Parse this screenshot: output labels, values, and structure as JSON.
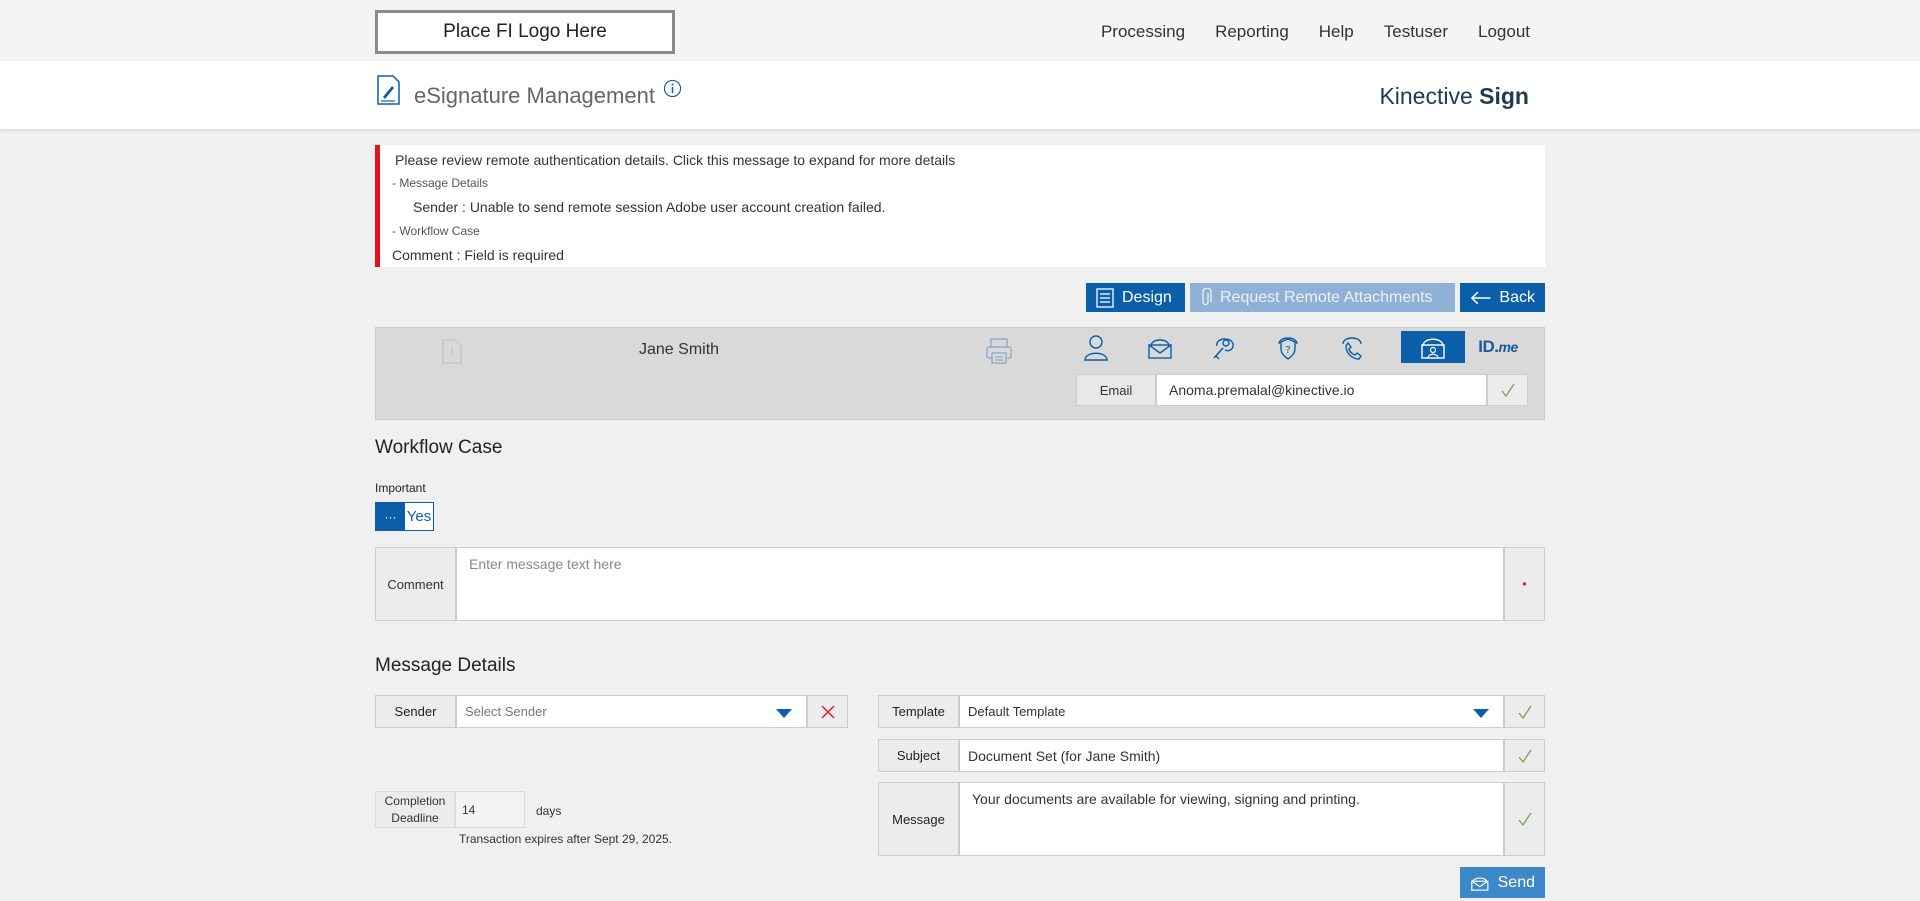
{
  "header": {
    "logo_text": "Place FI Logo Here",
    "nav": [
      "Processing",
      "Reporting",
      "Help",
      "Testuser",
      "Logout"
    ]
  },
  "titlebar": {
    "title": "eSignature Management",
    "brand_light": "Kinective ",
    "brand_bold": "Sign"
  },
  "alert": {
    "main": "Please review remote authentication details. Click this message to expand for more details",
    "section1": "- Message Details",
    "detail1": "Sender :  Unable to send remote session Adobe user account creation failed.",
    "section2": "- Workflow Case",
    "detail2": "Comment :  Field is required",
    "color": "#e3131c"
  },
  "actions": {
    "design": "Design",
    "request_attachments": "Request Remote Attachments",
    "back": "Back"
  },
  "signer": {
    "name": "Jane Smith",
    "auth_icons": [
      "person-icon",
      "email-cloud-icon",
      "key-icon",
      "security-question-icon",
      "phone-icon",
      "remote-cloud-icon",
      "idme-icon"
    ],
    "active_auth": "remote-cloud-icon",
    "idme_label_id": "ID.",
    "idme_label_me": "me",
    "email_label": "Email",
    "email_value": "Anoma.premalal@kinective.io"
  },
  "workflow": {
    "heading": "Workflow Case",
    "important_label": "Important",
    "toggle_knob": "···",
    "toggle_value": "Yes",
    "comment_label": "Comment",
    "comment_placeholder": "Enter message text here",
    "required_mark": "•"
  },
  "message": {
    "heading": "Message Details",
    "sender_label": "Sender",
    "sender_placeholder": "Select Sender",
    "template_label": "Template",
    "template_value": "Default Template",
    "subject_label": "Subject",
    "subject_value": "Document Set (for Jane Smith)",
    "message_label": "Message",
    "message_value": "Your documents are available for viewing, signing and printing.",
    "deadline_label_1": "Completion",
    "deadline_label_2": "Deadline",
    "deadline_value": "14",
    "deadline_unit": "days",
    "expires_text": "Transaction expires after Sept 29, 2025.",
    "send": "Send"
  },
  "colors": {
    "primary": "#0a5fa8",
    "disabled": "#8fb1d6",
    "error": "#e3131c",
    "ok_check": "#7aa84f"
  }
}
